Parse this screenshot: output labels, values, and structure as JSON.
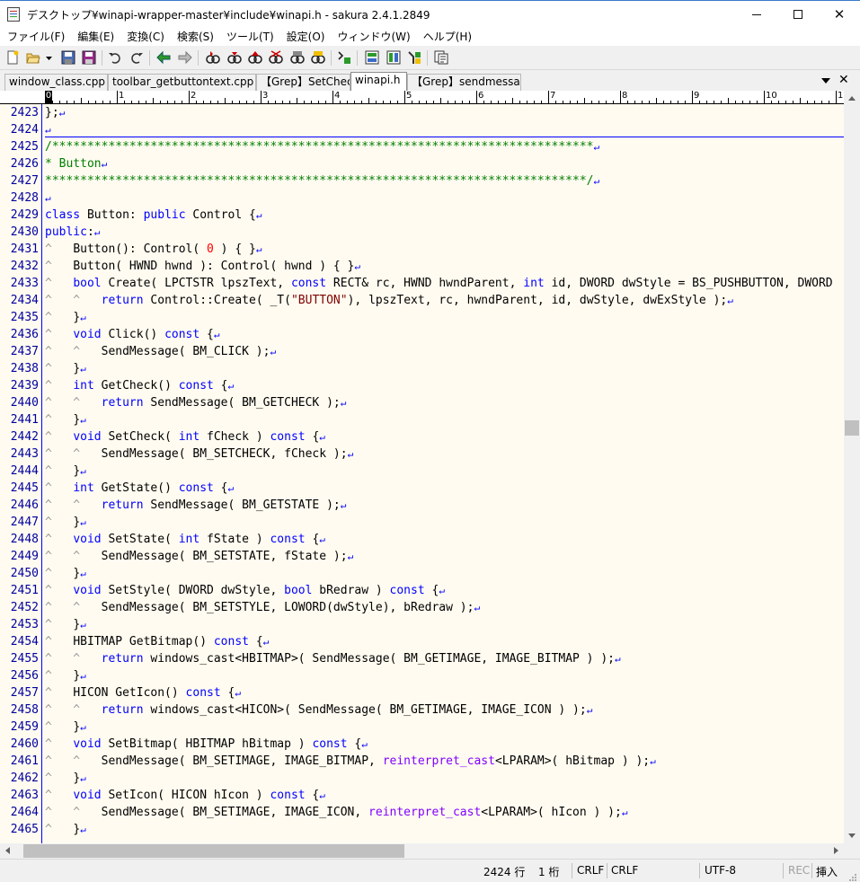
{
  "window": {
    "title": "デスクトップ¥winapi-wrapper-master¥include¥winapi.h - sakura 2.4.1.2849",
    "minimize_icon": "minimize-icon",
    "maximize_icon": "maximize-icon",
    "close_label": "✕"
  },
  "menu": [
    "ファイル(F)",
    "編集(E)",
    "変換(C)",
    "検索(S)",
    "ツール(T)",
    "設定(O)",
    "ウィンドウ(W)",
    "ヘルプ(H)"
  ],
  "toolbar": {
    "icons": [
      "new-file-icon",
      "open-file-icon",
      "open-dropdown-icon",
      "save-icon",
      "save-all-icon",
      "undo-icon",
      "redo-icon",
      "jump-back-icon",
      "jump-forward-icon",
      "search-prev-icon",
      "search-next-icon",
      "search-marked-icon",
      "search-clear-icon",
      "bookmark-icon",
      "grep-icon",
      "compare-icon",
      "outline-icon",
      "macro-icon",
      "bookmark-list-icon",
      "settings-icon"
    ]
  },
  "tabs": [
    {
      "label": "window_class.cpp",
      "active": false
    },
    {
      "label": "toolbar_getbuttontext.cpp",
      "active": false
    },
    {
      "label": "【Grep】SetCheck",
      "active": false
    },
    {
      "label": "winapi.h",
      "active": true
    },
    {
      "label": "【Grep】sendmessage",
      "active": false
    }
  ],
  "ruler": {
    "numbers": [
      "1",
      "2",
      "3",
      "4",
      "5",
      "6",
      "7",
      "8",
      "9",
      "10",
      "1"
    ],
    "cursor_label": "0"
  },
  "editor": {
    "colors": {
      "background": "#fffbf0",
      "keyword": "#0000ff",
      "comment": "#008000",
      "string": "#800000",
      "number": "#ff0000",
      "function": "#8000ff",
      "line_number": "#0000a0"
    },
    "lines": [
      {
        "n": "2423",
        "t": [
          [
            "};",
            ""
          ]
        ],
        "eol": "↵"
      },
      {
        "n": "2424",
        "t": [],
        "eol": "↵"
      },
      {
        "n": "2425",
        "t": [
          [
            "/*****************************************************************************",
            "cm"
          ]
        ],
        "eol": "↵"
      },
      {
        "n": "2426",
        "t": [
          [
            "* Button",
            "cm"
          ]
        ],
        "eol": "↵"
      },
      {
        "n": "2427",
        "t": [
          [
            "*****************************************************************************/",
            "cm"
          ]
        ],
        "eol": "↵"
      },
      {
        "n": "2428",
        "t": [],
        "eol": "↵"
      },
      {
        "n": "2429",
        "t": [
          [
            "class",
            "kw"
          ],
          [
            " Button: ",
            ""
          ],
          [
            "public",
            "kw"
          ],
          [
            " Control {",
            ""
          ]
        ],
        "eol": "↵"
      },
      {
        "n": "2430",
        "t": [
          [
            "public",
            "kw"
          ],
          [
            ":",
            ""
          ]
        ],
        "eol": "↵"
      },
      {
        "n": "2431",
        "t": [
          [
            "^   ",
            "tabmk"
          ],
          [
            "Button(): Control( ",
            ""
          ],
          [
            "0",
            "nm"
          ],
          [
            " ) { }",
            ""
          ]
        ],
        "eol": "↵"
      },
      {
        "n": "2432",
        "t": [
          [
            "^   ",
            "tabmk"
          ],
          [
            "Button( HWND hwnd ): Control( hwnd ) { }",
            ""
          ]
        ],
        "eol": "↵"
      },
      {
        "n": "2433",
        "t": [
          [
            "^   ",
            "tabmk"
          ],
          [
            "bool",
            "kw"
          ],
          [
            " Create( LPCTSTR lpszText, ",
            ""
          ],
          [
            "const",
            "kw"
          ],
          [
            " RECT& rc, HWND hwndParent, ",
            ""
          ],
          [
            "int",
            "kw"
          ],
          [
            " id, DWORD dwStyle = BS_PUSHBUTTON, DWORD",
            ""
          ]
        ],
        "eol": ""
      },
      {
        "n": "2434",
        "t": [
          [
            "^   ^   ",
            "tabmk"
          ],
          [
            "return",
            "kw"
          ],
          [
            " Control::Create( _T(",
            ""
          ],
          [
            "\"BUTTON\"",
            "st"
          ],
          [
            "), lpszText, rc, hwndParent, id, dwStyle, dwExStyle );",
            ""
          ]
        ],
        "eol": "↵"
      },
      {
        "n": "2435",
        "t": [
          [
            "^   ",
            "tabmk"
          ],
          [
            "}",
            ""
          ]
        ],
        "eol": "↵"
      },
      {
        "n": "2436",
        "t": [
          [
            "^   ",
            "tabmk"
          ],
          [
            "void",
            "kw"
          ],
          [
            " Click() ",
            ""
          ],
          [
            "const",
            "kw"
          ],
          [
            " {",
            ""
          ]
        ],
        "eol": "↵"
      },
      {
        "n": "2437",
        "t": [
          [
            "^   ^   ",
            "tabmk"
          ],
          [
            "SendMessage( BM_CLICK );",
            ""
          ]
        ],
        "eol": "↵"
      },
      {
        "n": "2438",
        "t": [
          [
            "^   ",
            "tabmk"
          ],
          [
            "}",
            ""
          ]
        ],
        "eol": "↵"
      },
      {
        "n": "2439",
        "t": [
          [
            "^   ",
            "tabmk"
          ],
          [
            "int",
            "kw"
          ],
          [
            " GetCheck() ",
            ""
          ],
          [
            "const",
            "kw"
          ],
          [
            " {",
            ""
          ]
        ],
        "eol": "↵"
      },
      {
        "n": "2440",
        "t": [
          [
            "^   ^   ",
            "tabmk"
          ],
          [
            "return",
            "kw"
          ],
          [
            " SendMessage( BM_GETCHECK );",
            ""
          ]
        ],
        "eol": "↵"
      },
      {
        "n": "2441",
        "t": [
          [
            "^   ",
            "tabmk"
          ],
          [
            "}",
            ""
          ]
        ],
        "eol": "↵"
      },
      {
        "n": "2442",
        "t": [
          [
            "^   ",
            "tabmk"
          ],
          [
            "void",
            "kw"
          ],
          [
            " SetCheck( ",
            ""
          ],
          [
            "int",
            "kw"
          ],
          [
            " fCheck ) ",
            ""
          ],
          [
            "const",
            "kw"
          ],
          [
            " {",
            ""
          ]
        ],
        "eol": "↵"
      },
      {
        "n": "2443",
        "t": [
          [
            "^   ^   ",
            "tabmk"
          ],
          [
            "SendMessage( BM_SETCHECK, fCheck );",
            ""
          ]
        ],
        "eol": "↵"
      },
      {
        "n": "2444",
        "t": [
          [
            "^   ",
            "tabmk"
          ],
          [
            "}",
            ""
          ]
        ],
        "eol": "↵"
      },
      {
        "n": "2445",
        "t": [
          [
            "^   ",
            "tabmk"
          ],
          [
            "int",
            "kw"
          ],
          [
            " GetState() ",
            ""
          ],
          [
            "const",
            "kw"
          ],
          [
            " {",
            ""
          ]
        ],
        "eol": "↵"
      },
      {
        "n": "2446",
        "t": [
          [
            "^   ^   ",
            "tabmk"
          ],
          [
            "return",
            "kw"
          ],
          [
            " SendMessage( BM_GETSTATE );",
            ""
          ]
        ],
        "eol": "↵"
      },
      {
        "n": "2447",
        "t": [
          [
            "^   ",
            "tabmk"
          ],
          [
            "}",
            ""
          ]
        ],
        "eol": "↵"
      },
      {
        "n": "2448",
        "t": [
          [
            "^   ",
            "tabmk"
          ],
          [
            "void",
            "kw"
          ],
          [
            " SetState( ",
            ""
          ],
          [
            "int",
            "kw"
          ],
          [
            " fState ) ",
            ""
          ],
          [
            "const",
            "kw"
          ],
          [
            " {",
            ""
          ]
        ],
        "eol": "↵"
      },
      {
        "n": "2449",
        "t": [
          [
            "^   ^   ",
            "tabmk"
          ],
          [
            "SendMessage( BM_SETSTATE, fState );",
            ""
          ]
        ],
        "eol": "↵"
      },
      {
        "n": "2450",
        "t": [
          [
            "^   ",
            "tabmk"
          ],
          [
            "}",
            ""
          ]
        ],
        "eol": "↵"
      },
      {
        "n": "2451",
        "t": [
          [
            "^   ",
            "tabmk"
          ],
          [
            "void",
            "kw"
          ],
          [
            " SetStyle( DWORD dwStyle, ",
            ""
          ],
          [
            "bool",
            "kw"
          ],
          [
            " bRedraw ) ",
            ""
          ],
          [
            "const",
            "kw"
          ],
          [
            " {",
            ""
          ]
        ],
        "eol": "↵"
      },
      {
        "n": "2452",
        "t": [
          [
            "^   ^   ",
            "tabmk"
          ],
          [
            "SendMessage( BM_SETSTYLE, LOWORD(dwStyle), bRedraw );",
            ""
          ]
        ],
        "eol": "↵"
      },
      {
        "n": "2453",
        "t": [
          [
            "^   ",
            "tabmk"
          ],
          [
            "}",
            ""
          ]
        ],
        "eol": "↵"
      },
      {
        "n": "2454",
        "t": [
          [
            "^   ",
            "tabmk"
          ],
          [
            "HBITMAP GetBitmap() ",
            ""
          ],
          [
            "const",
            "kw"
          ],
          [
            " {",
            ""
          ]
        ],
        "eol": "↵"
      },
      {
        "n": "2455",
        "t": [
          [
            "^   ^   ",
            "tabmk"
          ],
          [
            "return",
            "kw"
          ],
          [
            " windows_cast<HBITMAP>( SendMessage( BM_GETIMAGE, IMAGE_BITMAP ) );",
            ""
          ]
        ],
        "eol": "↵"
      },
      {
        "n": "2456",
        "t": [
          [
            "^   ",
            "tabmk"
          ],
          [
            "}",
            ""
          ]
        ],
        "eol": "↵"
      },
      {
        "n": "2457",
        "t": [
          [
            "^   ",
            "tabmk"
          ],
          [
            "HICON GetIcon() ",
            ""
          ],
          [
            "const",
            "kw"
          ],
          [
            " {",
            ""
          ]
        ],
        "eol": "↵"
      },
      {
        "n": "2458",
        "t": [
          [
            "^   ^   ",
            "tabmk"
          ],
          [
            "return",
            "kw"
          ],
          [
            " windows_cast<HICON>( SendMessage( BM_GETIMAGE, IMAGE_ICON ) );",
            ""
          ]
        ],
        "eol": "↵"
      },
      {
        "n": "2459",
        "t": [
          [
            "^   ",
            "tabmk"
          ],
          [
            "}",
            ""
          ]
        ],
        "eol": "↵"
      },
      {
        "n": "2460",
        "t": [
          [
            "^   ",
            "tabmk"
          ],
          [
            "void",
            "kw"
          ],
          [
            " SetBitmap( HBITMAP hBitmap ) ",
            ""
          ],
          [
            "const",
            "kw"
          ],
          [
            " {",
            ""
          ]
        ],
        "eol": "↵"
      },
      {
        "n": "2461",
        "t": [
          [
            "^   ^   ",
            "tabmk"
          ],
          [
            "SendMessage( BM_SETIMAGE, IMAGE_BITMAP, ",
            ""
          ],
          [
            "reinterpret_cast",
            "fn"
          ],
          [
            "<LPARAM>( hBitmap ) );",
            ""
          ]
        ],
        "eol": "↵"
      },
      {
        "n": "2462",
        "t": [
          [
            "^   ",
            "tabmk"
          ],
          [
            "}",
            ""
          ]
        ],
        "eol": "↵"
      },
      {
        "n": "2463",
        "t": [
          [
            "^   ",
            "tabmk"
          ],
          [
            "void",
            "kw"
          ],
          [
            " SetIcon( HICON hIcon ) ",
            ""
          ],
          [
            "const",
            "kw"
          ],
          [
            " {",
            ""
          ]
        ],
        "eol": "↵"
      },
      {
        "n": "2464",
        "t": [
          [
            "^   ^   ",
            "tabmk"
          ],
          [
            "SendMessage( BM_SETIMAGE, IMAGE_ICON, ",
            ""
          ],
          [
            "reinterpret_cast",
            "fn"
          ],
          [
            "<LPARAM>( hIcon ) );",
            ""
          ]
        ],
        "eol": "↵"
      },
      {
        "n": "2465",
        "t": [
          [
            "^   ",
            "tabmk"
          ],
          [
            "}",
            ""
          ]
        ],
        "eol": "↵"
      }
    ]
  },
  "status": {
    "line": "2424 行",
    "column": "1 桁",
    "eol1": "CRLF",
    "eol2": "CRLF",
    "encoding": "UTF-8",
    "rec": "REC",
    "mode": "挿入"
  }
}
